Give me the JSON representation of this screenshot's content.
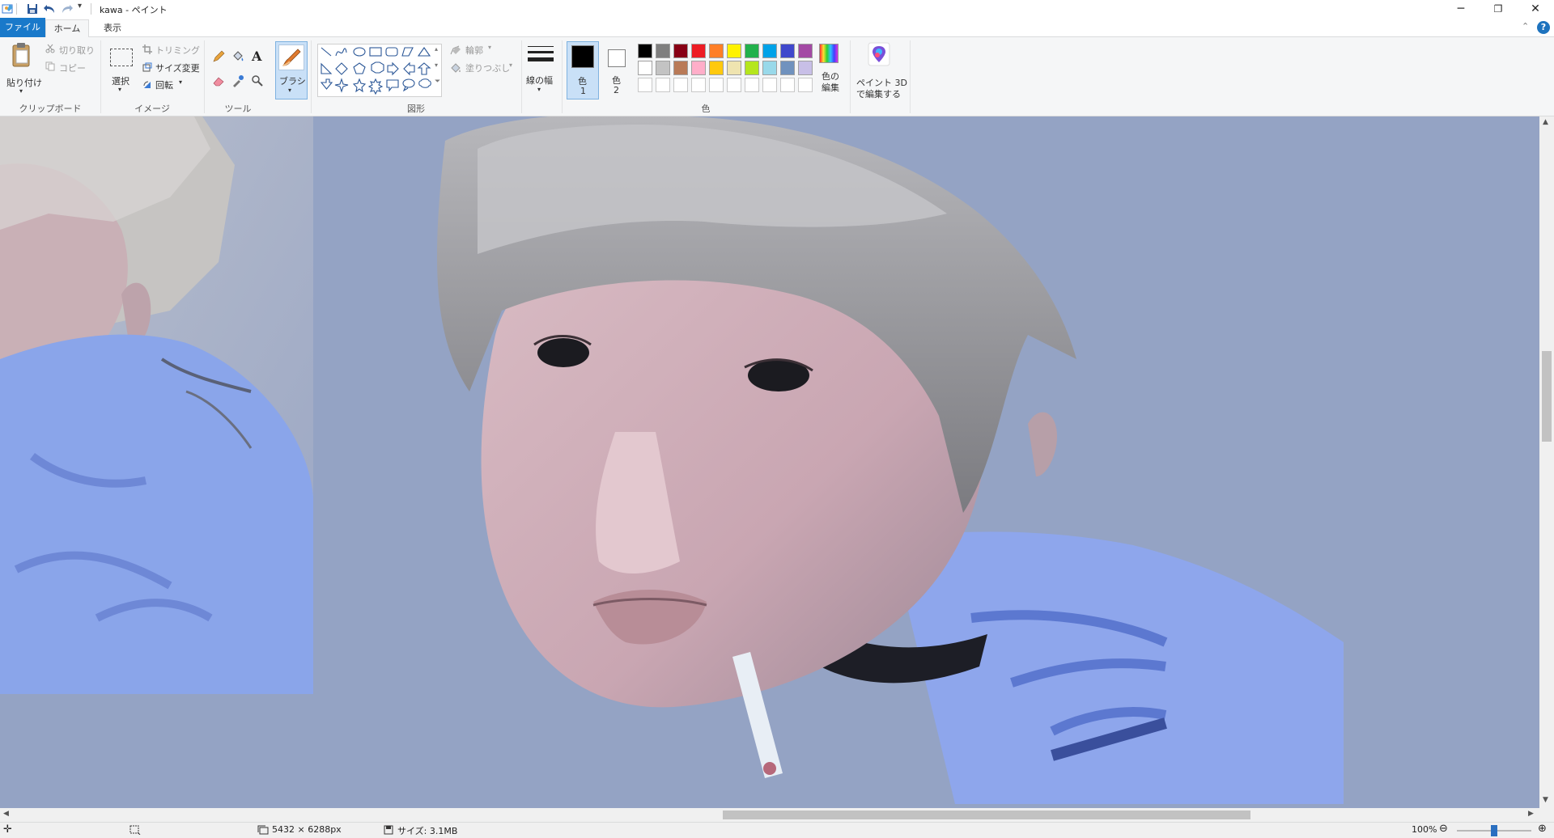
{
  "window": {
    "title": "kawa - ペイント",
    "minimize_label": "─",
    "maximize_label": "❐",
    "close_label": "✕"
  },
  "tabs": {
    "file": "ファイル",
    "home": "ホーム",
    "view": "表示"
  },
  "clipboard": {
    "paste": "貼り付け",
    "cut": "切り取り",
    "copy": "コピー",
    "group": "クリップボード"
  },
  "image": {
    "select": "選択",
    "crop": "トリミング",
    "resize": "サイズ変更",
    "rotate": "回転",
    "group": "イメージ"
  },
  "tools": {
    "group": "ツール",
    "text_glyph": "A"
  },
  "brush": {
    "label": "ブラシ"
  },
  "shapes": {
    "outline": "輪郭",
    "fill": "塗りつぶし",
    "group": "図形"
  },
  "size": {
    "label": "線の幅"
  },
  "colors": {
    "color1_label": "色",
    "color1_num": "1",
    "color2_label": "色",
    "color2_num": "2",
    "edit_line1": "色の",
    "edit_line2": "編集",
    "group": "色",
    "color1": "#000000",
    "color2": "#ffffff",
    "palette_row1": [
      "#000000",
      "#7f7f7f",
      "#880015",
      "#ed1c24",
      "#ff7f27",
      "#fff200",
      "#22b14c",
      "#00a2e8",
      "#3f48cc",
      "#a349a4"
    ],
    "palette_row2": [
      "#ffffff",
      "#c3c3c3",
      "#b97a57",
      "#ffaec9",
      "#ffc90e",
      "#efe4b0",
      "#b5e61d",
      "#99d9ea",
      "#7092be",
      "#c8bfe7"
    ]
  },
  "paint3d": {
    "line1": "ペイント 3D",
    "line2": "で編集する"
  },
  "status": {
    "dimensions": "5432 × 6288px",
    "filesize": "サイズ: 3.1MB",
    "zoom": "100%"
  }
}
